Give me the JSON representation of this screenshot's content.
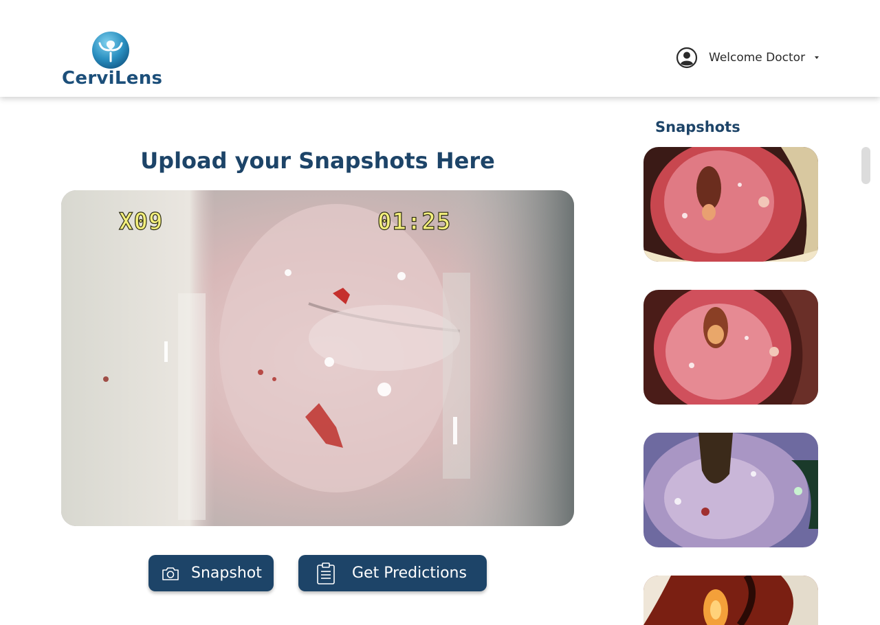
{
  "header": {
    "brand": "CerviLens",
    "user_label": "Welcome Doctor"
  },
  "main": {
    "title": "Upload your Snapshots Here",
    "video": {
      "overlay_left": "X09",
      "overlay_right": "01:25"
    },
    "buttons": {
      "snapshot": "Snapshot",
      "predict": "Get Predictions"
    }
  },
  "sidebar": {
    "title": "Snapshots",
    "thumbnails": [
      {
        "icon": "colposcopy-image"
      },
      {
        "icon": "colposcopy-image"
      },
      {
        "icon": "colposcopy-image"
      },
      {
        "icon": "colposcopy-image"
      }
    ]
  },
  "colors": {
    "brand": "#1d4468",
    "background": "#ffffff",
    "overlay_text": "#f3ef7c"
  }
}
